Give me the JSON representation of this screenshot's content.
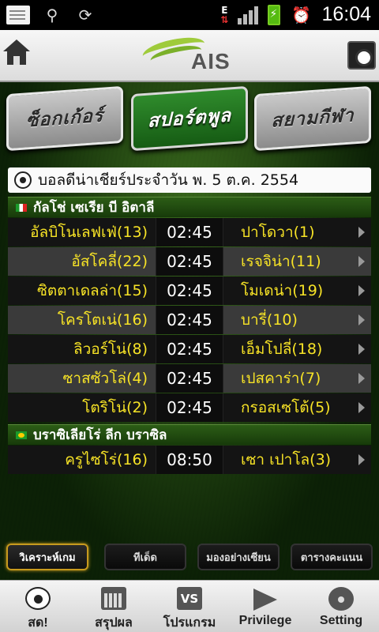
{
  "status_bar": {
    "time": "16:04",
    "network_letter": "E",
    "icons": [
      "message-icon",
      "usb-icon",
      "sync-icon",
      "signal-icon",
      "battery-charging-icon",
      "alarm-icon"
    ]
  },
  "header": {
    "brand": "AIS",
    "brand_color": "#9fcb3b",
    "home_icon": "home-icon",
    "camera_icon": "camera-ball-icon"
  },
  "plates": [
    {
      "label": "ซ็อกเก้อร์",
      "active": false
    },
    {
      "label": "สปอร์ตพูล",
      "active": true
    },
    {
      "label": "สยามกีฬา",
      "active": false
    }
  ],
  "date_bar": {
    "text": "บอลดีน่าเชียร์ประจำวัน พ. 5 ต.ค. 2554"
  },
  "leagues": [
    {
      "name": "กัลโช่ เซเรีย บี อิตาลี",
      "flag": "italy-flag-icon",
      "matches": [
        {
          "home": "อัลบิโนเลฟเฟ่(13)",
          "time": "02:45",
          "away": "ปาโดวา(1)"
        },
        {
          "home": "อัสโคลี่(22)",
          "time": "02:45",
          "away": "เรจจิน่า(11)"
        },
        {
          "home": "ซิตตาเดลล่า(15)",
          "time": "02:45",
          "away": "โมเดน่า(19)"
        },
        {
          "home": "โครโตเน่(16)",
          "time": "02:45",
          "away": "บารี่(10)"
        },
        {
          "home": "ลิวอร์โน่(8)",
          "time": "02:45",
          "away": "เอ็มโปลี่(18)"
        },
        {
          "home": "ซาสซัวโล่(4)",
          "time": "02:45",
          "away": "เปสคาร่า(7)"
        },
        {
          "home": "โตริโน่(2)",
          "time": "02:45",
          "away": "กรอสเซโต้(5)"
        }
      ]
    },
    {
      "name": "บราซิเลียโร่ ลีก บราซิล",
      "flag": "brazil-flag-icon",
      "matches": [
        {
          "home": "ครูไซโร่(16)",
          "time": "08:50",
          "away": "เซา เปาโล(3)"
        }
      ]
    }
  ],
  "sub_tabs": [
    {
      "label": "วิเคราะห์เกม",
      "active": true
    },
    {
      "label": "ทีเด็ด",
      "active": false
    },
    {
      "label": "มองอย่างเซียน",
      "active": false
    },
    {
      "label": "ตารางคะแนน",
      "active": false
    }
  ],
  "bottom_nav": [
    {
      "label": "สด!",
      "icon": "soccer-ball-icon"
    },
    {
      "label": "สรุปผล",
      "icon": "calendar-icon"
    },
    {
      "label": "โปรแกรม",
      "icon": "vs-icon"
    },
    {
      "label": "Privilege",
      "icon": "megaphone-icon"
    },
    {
      "label": "Setting",
      "icon": "gear-icon"
    }
  ],
  "colors": {
    "team_text": "#f7e326",
    "league_bar": "#2c5d16",
    "active_tab_border": "#c79a1e"
  }
}
